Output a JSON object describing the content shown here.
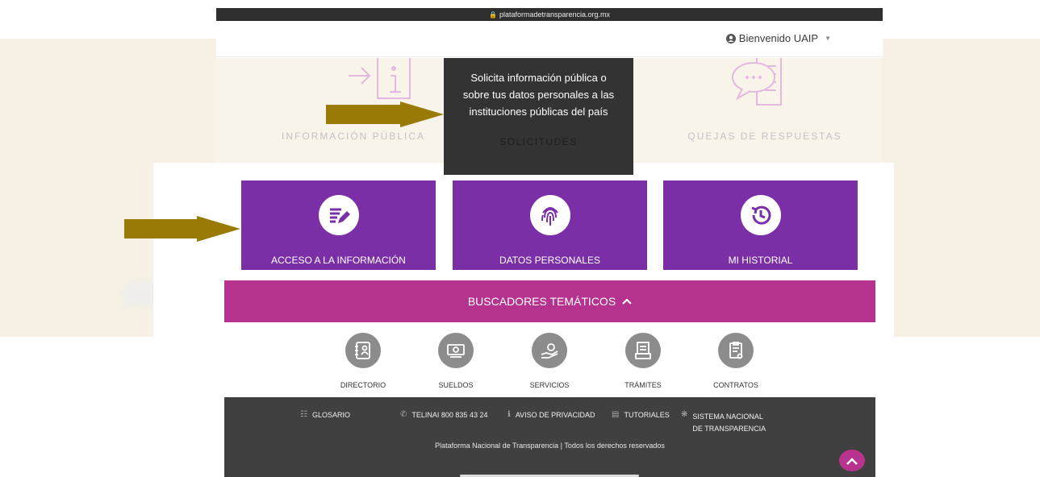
{
  "browser": {
    "url": "plataformadetransparencia.org.mx"
  },
  "header": {
    "welcome": "Bienvenido UAIP"
  },
  "top_row": {
    "left_label": "INFORMACIÓN PÚBLICA",
    "right_label": "QUEJAS DE RESPUESTAS",
    "tooltip_text": "Solicita información pública o sobre tus datos personales a las instituciones públicas del país",
    "tooltip_title": "SOLICITUDES"
  },
  "cards": [
    {
      "label": "ACCESO A LA INFORMACIÓN",
      "icon": "edit-list-icon"
    },
    {
      "label": "DATOS PERSONALES",
      "icon": "fingerprint-icon"
    },
    {
      "label": "MI HISTORIAL",
      "icon": "history-icon"
    }
  ],
  "buscadores": {
    "label": "BUSCADORES TEMÁTICOS"
  },
  "topics": [
    {
      "label": "DIRECTORIO",
      "icon": "directory-icon"
    },
    {
      "label": "SUELDOS",
      "icon": "money-icon"
    },
    {
      "label": "SERVICIOS",
      "icon": "services-icon"
    },
    {
      "label": "TRÁMITES",
      "icon": "procedures-icon"
    },
    {
      "label": "CONTRATOS",
      "icon": "contracts-icon"
    }
  ],
  "footer": {
    "links": [
      {
        "label": "GLOSARIO",
        "icon": "book-icon"
      },
      {
        "label": "TELINAI 800 835 43 24",
        "icon": "phone-icon"
      },
      {
        "label": "AVISO DE PRIVACIDAD",
        "icon": "info-icon"
      },
      {
        "label": "TUTORIALES",
        "icon": "document-icon"
      },
      {
        "label": "SISTEMA NACIONAL DE TRANSPARENCIA",
        "icon": "network-icon"
      }
    ],
    "copyright": "Plataforma Nacional de Transparencia | Todos los derechos reservados"
  },
  "colors": {
    "purple": "#7b2fa7",
    "magenta": "#b5338f",
    "dark": "#333333",
    "footer": "#404040",
    "arrow": "#9a7a06"
  }
}
